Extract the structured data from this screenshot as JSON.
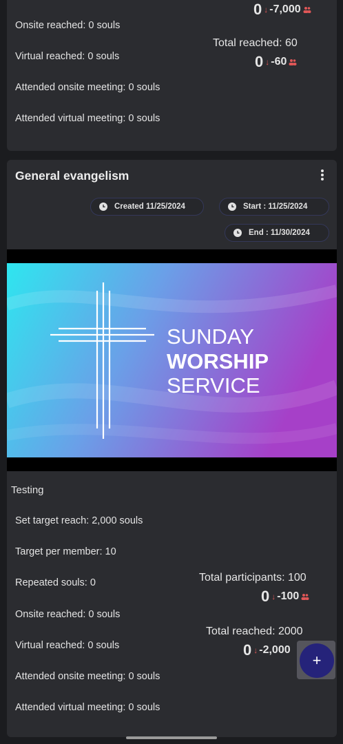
{
  "card1": {
    "top_delta": {
      "zero": "0",
      "arrow": "↓",
      "num": "-7,000"
    },
    "stats": {
      "onsite": "Onsite reached: 0 souls",
      "virtual": "Virtual reached: 0 souls",
      "attended_onsite": "Attended onsite meeting: 0 souls",
      "attended_virtual": "Attended virtual meeting: 0 souls"
    },
    "total_reached": "Total reached: 60",
    "reached_delta": {
      "zero": "0",
      "arrow": "↓",
      "num": "-60"
    }
  },
  "card2": {
    "title": "General evangelism",
    "chips": {
      "created": "Created 11/25/2024",
      "start": "Start : 11/25/2024",
      "end": "End : 11/30/2024"
    },
    "banner": {
      "line1": "SUNDAY",
      "line2": "WORSHIP",
      "line3": "SERVICE"
    },
    "description": "Testing",
    "stats": {
      "target_reach": "Set target reach: 2,000 souls",
      "target_per_member": "Target per member: 10",
      "repeated": "Repeated souls: 0",
      "onsite": "Onsite reached: 0 souls",
      "virtual": "Virtual reached: 0 souls",
      "attended_onsite": "Attended onsite meeting: 0 souls",
      "attended_virtual": "Attended virtual meeting: 0 souls"
    },
    "total_participants": "Total participants: 100",
    "participants_delta": {
      "zero": "0",
      "arrow": "↓",
      "num": "-100"
    },
    "total_reached": "Total reached: 2000",
    "reached_delta": {
      "zero": "0",
      "arrow": "↓",
      "num": "-2,000"
    }
  },
  "fab": {
    "label": "+"
  },
  "icons": {
    "people": "people-icon",
    "clock": "clock-icon",
    "menu": "more-vert-icon",
    "add": "add-icon"
  },
  "colors": {
    "accent": "#25237a",
    "decrease": "#e05757",
    "card": "#2b2c30",
    "background": "#1b1c1f"
  }
}
